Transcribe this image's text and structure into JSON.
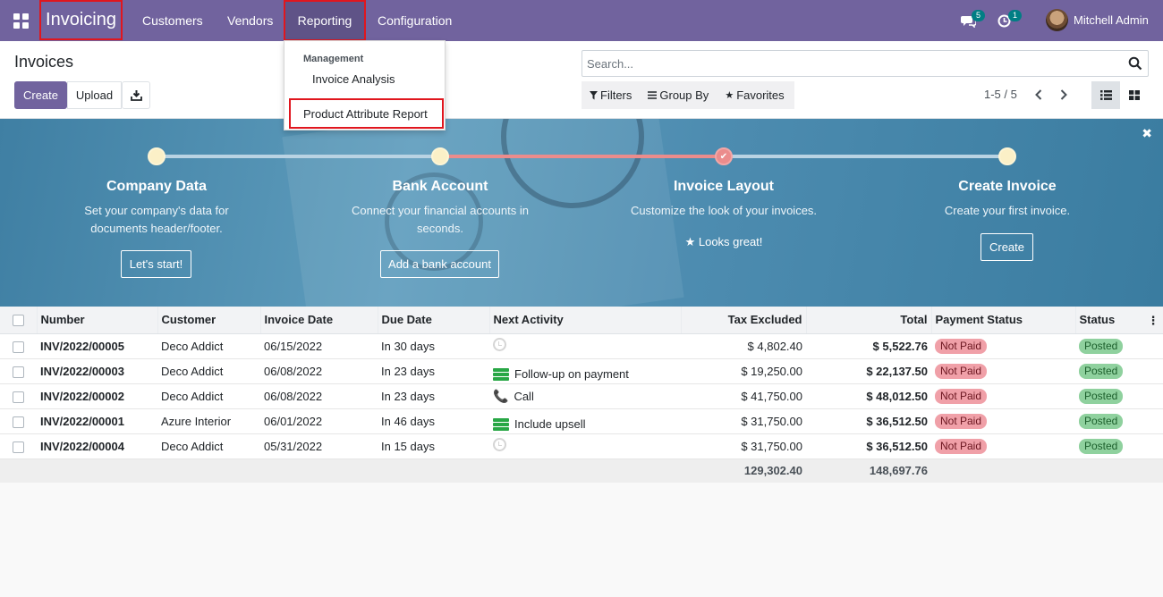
{
  "navbar": {
    "app_name": "Invoicing",
    "menu": [
      "Customers",
      "Vendors",
      "Reporting",
      "Configuration"
    ],
    "messages_count": "5",
    "activities_count": "1",
    "user_name": "Mitchell Admin"
  },
  "reporting_menu": {
    "section_header": "Management",
    "items": [
      "Invoice Analysis",
      "Product Attribute Report"
    ]
  },
  "control_panel": {
    "title": "Invoices",
    "create_label": "Create",
    "upload_label": "Upload",
    "search_placeholder": "Search...",
    "filters_label": "Filters",
    "group_by_label": "Group By",
    "favorites_label": "Favorites",
    "pager": "1-5 / 5"
  },
  "onboarding": {
    "steps": [
      {
        "title": "Company Data",
        "desc1": "Set your company's data for",
        "desc2": "documents header/footer.",
        "button": "Let's start!"
      },
      {
        "title": "Bank Account",
        "desc1": "Connect your financial accounts in",
        "desc2": "seconds.",
        "button": "Add a bank account"
      },
      {
        "title": "Invoice Layout",
        "desc1": "Customize the look of your invoices.",
        "desc2": "",
        "done_text": "Looks great!"
      },
      {
        "title": "Create Invoice",
        "desc1": "Create your first invoice.",
        "desc2": "",
        "button": "Create"
      }
    ]
  },
  "table": {
    "headers": [
      "Number",
      "Customer",
      "Invoice Date",
      "Due Date",
      "Next Activity",
      "Tax Excluded",
      "Total",
      "Payment Status",
      "Status"
    ],
    "rows": [
      {
        "number": "INV/2022/00005",
        "customer": "Deco Addict",
        "invoice_date": "06/15/2022",
        "due_date": "In 30 days",
        "activity": "",
        "activity_icon": "clock-icon",
        "tax_excluded": "$ 4,802.40",
        "total": "$ 5,522.76",
        "payment_status": "Not Paid",
        "status": "Posted"
      },
      {
        "number": "INV/2022/00003",
        "customer": "Deco Addict",
        "invoice_date": "06/08/2022",
        "due_date": "In 23 days",
        "activity": "Follow-up on payment",
        "activity_icon": "todo-list-icon",
        "tax_excluded": "$ 19,250.00",
        "total": "$ 22,137.50",
        "payment_status": "Not Paid",
        "status": "Posted"
      },
      {
        "number": "INV/2022/00002",
        "customer": "Deco Addict",
        "invoice_date": "06/08/2022",
        "due_date": "In 23 days",
        "activity": "Call",
        "activity_icon": "phone-icon",
        "tax_excluded": "$ 41,750.00",
        "total": "$ 48,012.50",
        "payment_status": "Not Paid",
        "status": "Posted"
      },
      {
        "number": "INV/2022/00001",
        "customer": "Azure Interior",
        "invoice_date": "06/01/2022",
        "due_date": "In 46 days",
        "activity": "Include upsell",
        "activity_icon": "todo-list-icon",
        "tax_excluded": "$ 31,750.00",
        "total": "$ 36,512.50",
        "payment_status": "Not Paid",
        "status": "Posted"
      },
      {
        "number": "INV/2022/00004",
        "customer": "Deco Addict",
        "invoice_date": "05/31/2022",
        "due_date": "In 15 days",
        "activity": "",
        "activity_icon": "clock-icon",
        "tax_excluded": "$ 31,750.00",
        "total": "$ 36,512.50",
        "payment_status": "Not Paid",
        "status": "Posted"
      }
    ],
    "totals": {
      "tax_excluded": "129,302.40",
      "total": "148,697.76"
    }
  },
  "colors": {
    "brand": "#71639e",
    "highlight_border": "#e0161e",
    "not_paid": "#f0a0a8",
    "posted": "#8fd19e"
  }
}
